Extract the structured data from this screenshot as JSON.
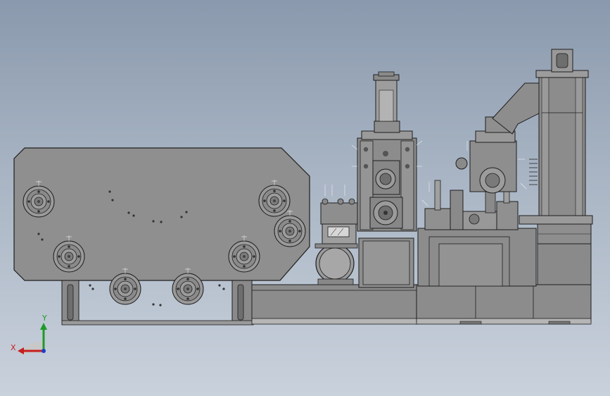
{
  "viewport": {
    "background_top": "#8a99ad",
    "background_bottom": "#c9d1dc",
    "body_fill": "#8d8d8d",
    "body_fill_light": "#a2a2a2",
    "edge_color": "#1e1e1e"
  },
  "triad": {
    "x_label": "X",
    "y_label": "Y",
    "x_color": "#c81e1e",
    "y_color": "#1e9a2a",
    "z_color": "#1e3cc8"
  }
}
